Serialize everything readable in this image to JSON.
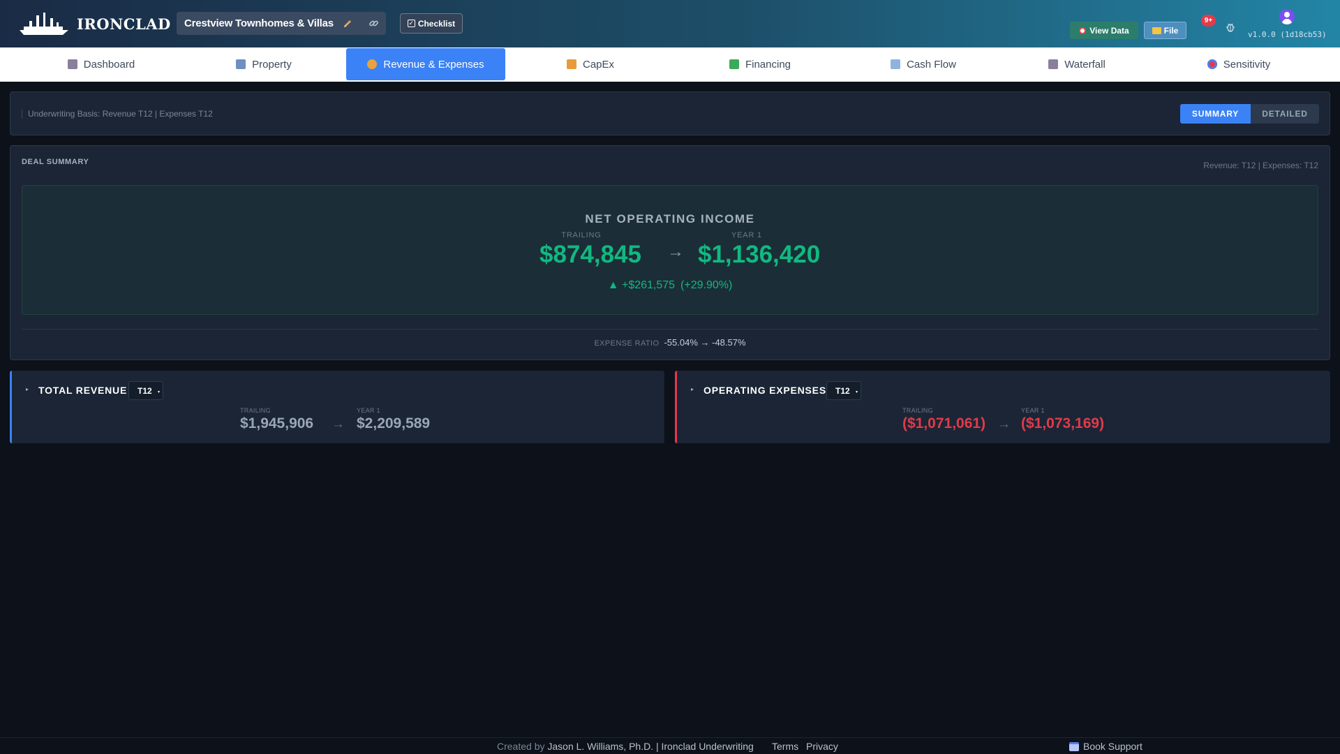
{
  "header": {
    "brand": "IRONCLAD",
    "project_name": "Crestview Townhomes & Villas",
    "checklist_label": "Checklist",
    "view_data_label": "View Data",
    "file_label": "File",
    "notification_count": "9+",
    "version": "v1.0.0 (1d18cb53)"
  },
  "nav": {
    "tabs": [
      {
        "label": "Dashboard",
        "icon": "bank-icon",
        "active": false
      },
      {
        "label": "Property",
        "icon": "building-icon",
        "active": false
      },
      {
        "label": "Revenue & Expenses",
        "icon": "money-bag-icon",
        "active": true
      },
      {
        "label": "CapEx",
        "icon": "crane-icon",
        "active": false
      },
      {
        "label": "Financing",
        "icon": "cash-icon",
        "active": false
      },
      {
        "label": "Cash Flow",
        "icon": "chart-up-icon",
        "active": false
      },
      {
        "label": "Waterfall",
        "icon": "bank-icon",
        "active": false
      },
      {
        "label": "Sensitivity",
        "icon": "target-icon",
        "active": false
      }
    ]
  },
  "basis": {
    "text": "Underwriting Basis: Revenue T12 | Expenses T12",
    "summary_label": "SUMMARY",
    "detailed_label": "DETAILED",
    "selected_view": "SUMMARY"
  },
  "deal_summary": {
    "title": "DEAL SUMMARY",
    "basis_note": "Revenue: T12 | Expenses: T12",
    "noi": {
      "title": "NET OPERATING INCOME",
      "trailing_label": "TRAILING",
      "trailing_value": "$874,845",
      "year1_label": "YEAR 1",
      "year1_value": "$1,136,420",
      "arrow": "→",
      "change": "▲ +$261,575",
      "change_pct": "(+29.90%)"
    },
    "expense_ratio": {
      "label": "EXPENSE RATIO",
      "value": "-55.04% → -48.57%"
    }
  },
  "revenue_card": {
    "title": "TOTAL REVENUE",
    "period": "T12",
    "trailing_label": "TRAILING",
    "trailing_value": "$1,945,906",
    "year1_label": "YEAR 1",
    "year1_value": "$2,209,589",
    "arrow": "→"
  },
  "expenses_card": {
    "title": "OPERATING EXPENSES",
    "period": "T12",
    "trailing_label": "TRAILING",
    "trailing_value": "($1,071,061)",
    "year1_label": "YEAR 1",
    "year1_value": "($1,073,169)",
    "arrow": "→"
  },
  "footer": {
    "created_by": "Created by",
    "author": "Jason L. Williams, Ph.D. | Ironclad Underwriting",
    "terms": "Terms",
    "privacy": "Privacy",
    "support": "Book Support"
  },
  "colors": {
    "accent": "#3b82f6",
    "positive": "#10b981",
    "negative": "#e23a4b",
    "background": "#0c111a",
    "panel": "#1b2535"
  }
}
